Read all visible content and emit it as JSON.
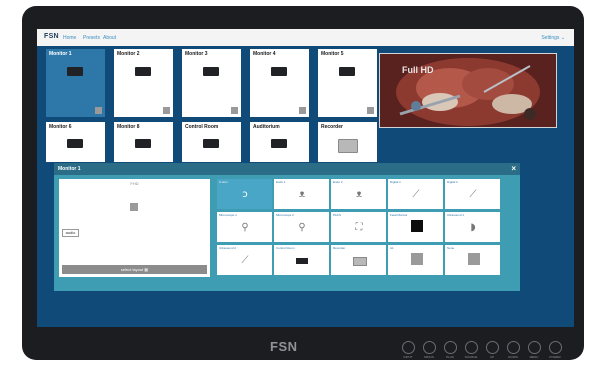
{
  "brand": {
    "logo": "FSN",
    "bezel_logo": "FSN"
  },
  "nav": {
    "home": "Home",
    "presets": "Presets",
    "about": "About",
    "settings": "Settings"
  },
  "monitors": [
    {
      "label": "Monitor 1",
      "active": true
    },
    {
      "label": "Monitor 2"
    },
    {
      "label": "Monitor 3"
    },
    {
      "label": "Monitor 4"
    },
    {
      "label": "Monitor 5"
    }
  ],
  "outputs": [
    {
      "label": "Monitor 6"
    },
    {
      "label": "Monitor 8"
    },
    {
      "label": "Control Room"
    },
    {
      "label": "Auditorium"
    },
    {
      "label": "Recorder"
    }
  ],
  "video": {
    "watermark": "Full HD"
  },
  "dialog": {
    "title": "Monitor 1",
    "preview_caption": "FHD",
    "audio_button": "audio",
    "layout_button": "select layout"
  },
  "sources": [
    {
      "label": "C-Arm",
      "icon": "c-arm-icon",
      "selected": true
    },
    {
      "label": "Endo 1",
      "icon": "endoscope-icon"
    },
    {
      "label": "Endo 2",
      "icon": "endoscope-icon"
    },
    {
      "label": "Digital 1",
      "icon": "probe-icon"
    },
    {
      "label": "Digital 2",
      "icon": "probe-icon"
    },
    {
      "label": "Microscope 1",
      "icon": "microscope-icon"
    },
    {
      "label": "Microscope 2",
      "icon": "microscope-icon"
    },
    {
      "label": "PACS",
      "icon": "xray-icon"
    },
    {
      "label": "Fetal Monitor",
      "icon": "dark-screen-icon"
    },
    {
      "label": "Ultrasound 1",
      "icon": "ultrasound-icon"
    },
    {
      "label": "Ultrasound 2",
      "icon": "ultrasound-probe-icon"
    },
    {
      "label": "Control Room",
      "icon": "monitor-icon"
    },
    {
      "label": "Recorder",
      "icon": "recorder-icon"
    },
    {
      "label": "A1",
      "icon": "grey-square-icon"
    },
    {
      "label": "None",
      "icon": "grey-square-icon"
    }
  ],
  "hardware_buttons": [
    "INPUT",
    "MINUS",
    "PLUS",
    "SOURCE",
    "UP",
    "DOWN",
    "MENU",
    "POWER"
  ],
  "colors": {
    "screen_bg": "#0f4a79",
    "dialog_bg": "#3f9db3",
    "dialog_header": "#2b6d86",
    "accent": "#2d78a8"
  }
}
